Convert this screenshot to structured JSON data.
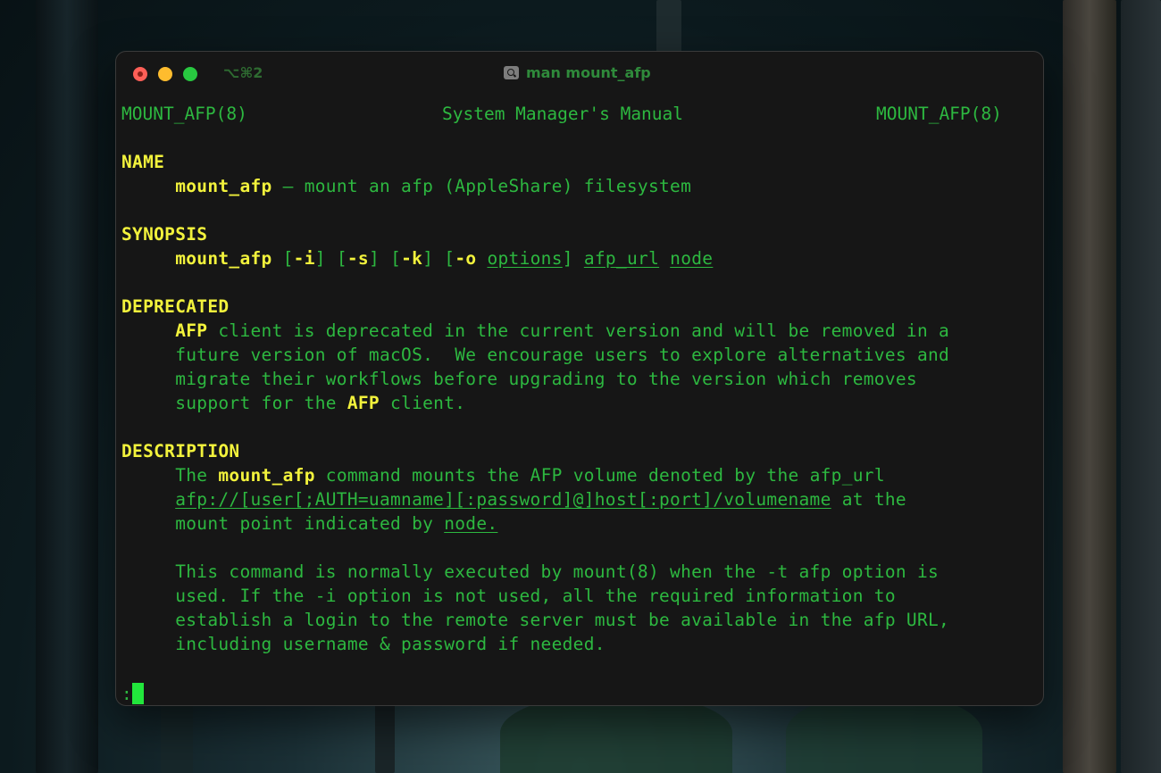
{
  "window": {
    "shortcut": "⌥⌘2",
    "title": "man mount_afp",
    "title_icon": "magnifier-icon"
  },
  "man": {
    "header_left": "MOUNT_AFP(8)",
    "header_center": "System Manager's Manual",
    "header_right": "MOUNT_AFP(8)",
    "name": {
      "heading": "NAME",
      "cmd": "mount_afp",
      "desc": " – mount an afp (AppleShare) filesystem"
    },
    "synopsis": {
      "heading": "SYNOPSIS",
      "cmd": "mount_afp",
      "flag_i": "-i",
      "flag_s": "-s",
      "flag_k": "-k",
      "flag_o": "-o",
      "options": "options",
      "afp_url": "afp_url",
      "node": "node"
    },
    "deprecated": {
      "heading": "DEPRECATED",
      "afp1": "AFP",
      "line1_rest": " client is deprecated in the current version and will be removed in a",
      "line2": "future version of macOS.  We encourage users to explore alternatives and",
      "line3": "migrate their workflows before upgrading to the version which removes",
      "line4_pre": "support for the ",
      "afp2": "AFP",
      "line4_post": " client."
    },
    "description": {
      "heading": "DESCRIPTION",
      "the": "The ",
      "cmd": "mount_afp",
      "line1_rest": " command mounts the AFP volume denoted by the afp_url",
      "url": "afp://[user[;AUTH=uamname][:password]@]host[:port]/volumename",
      "url_rest": " at the",
      "line3_pre": "mount point indicated by ",
      "node": "node.",
      "para2_line1": "This command is normally executed by mount(8) when the -t afp option is",
      "para2_line2": "used. If the -i option is not used, all the required information to",
      "para2_line3": "establish a login to the remote server must be available in the afp URL,",
      "para2_line4": "including username & password if needed."
    },
    "prompt": ":"
  }
}
